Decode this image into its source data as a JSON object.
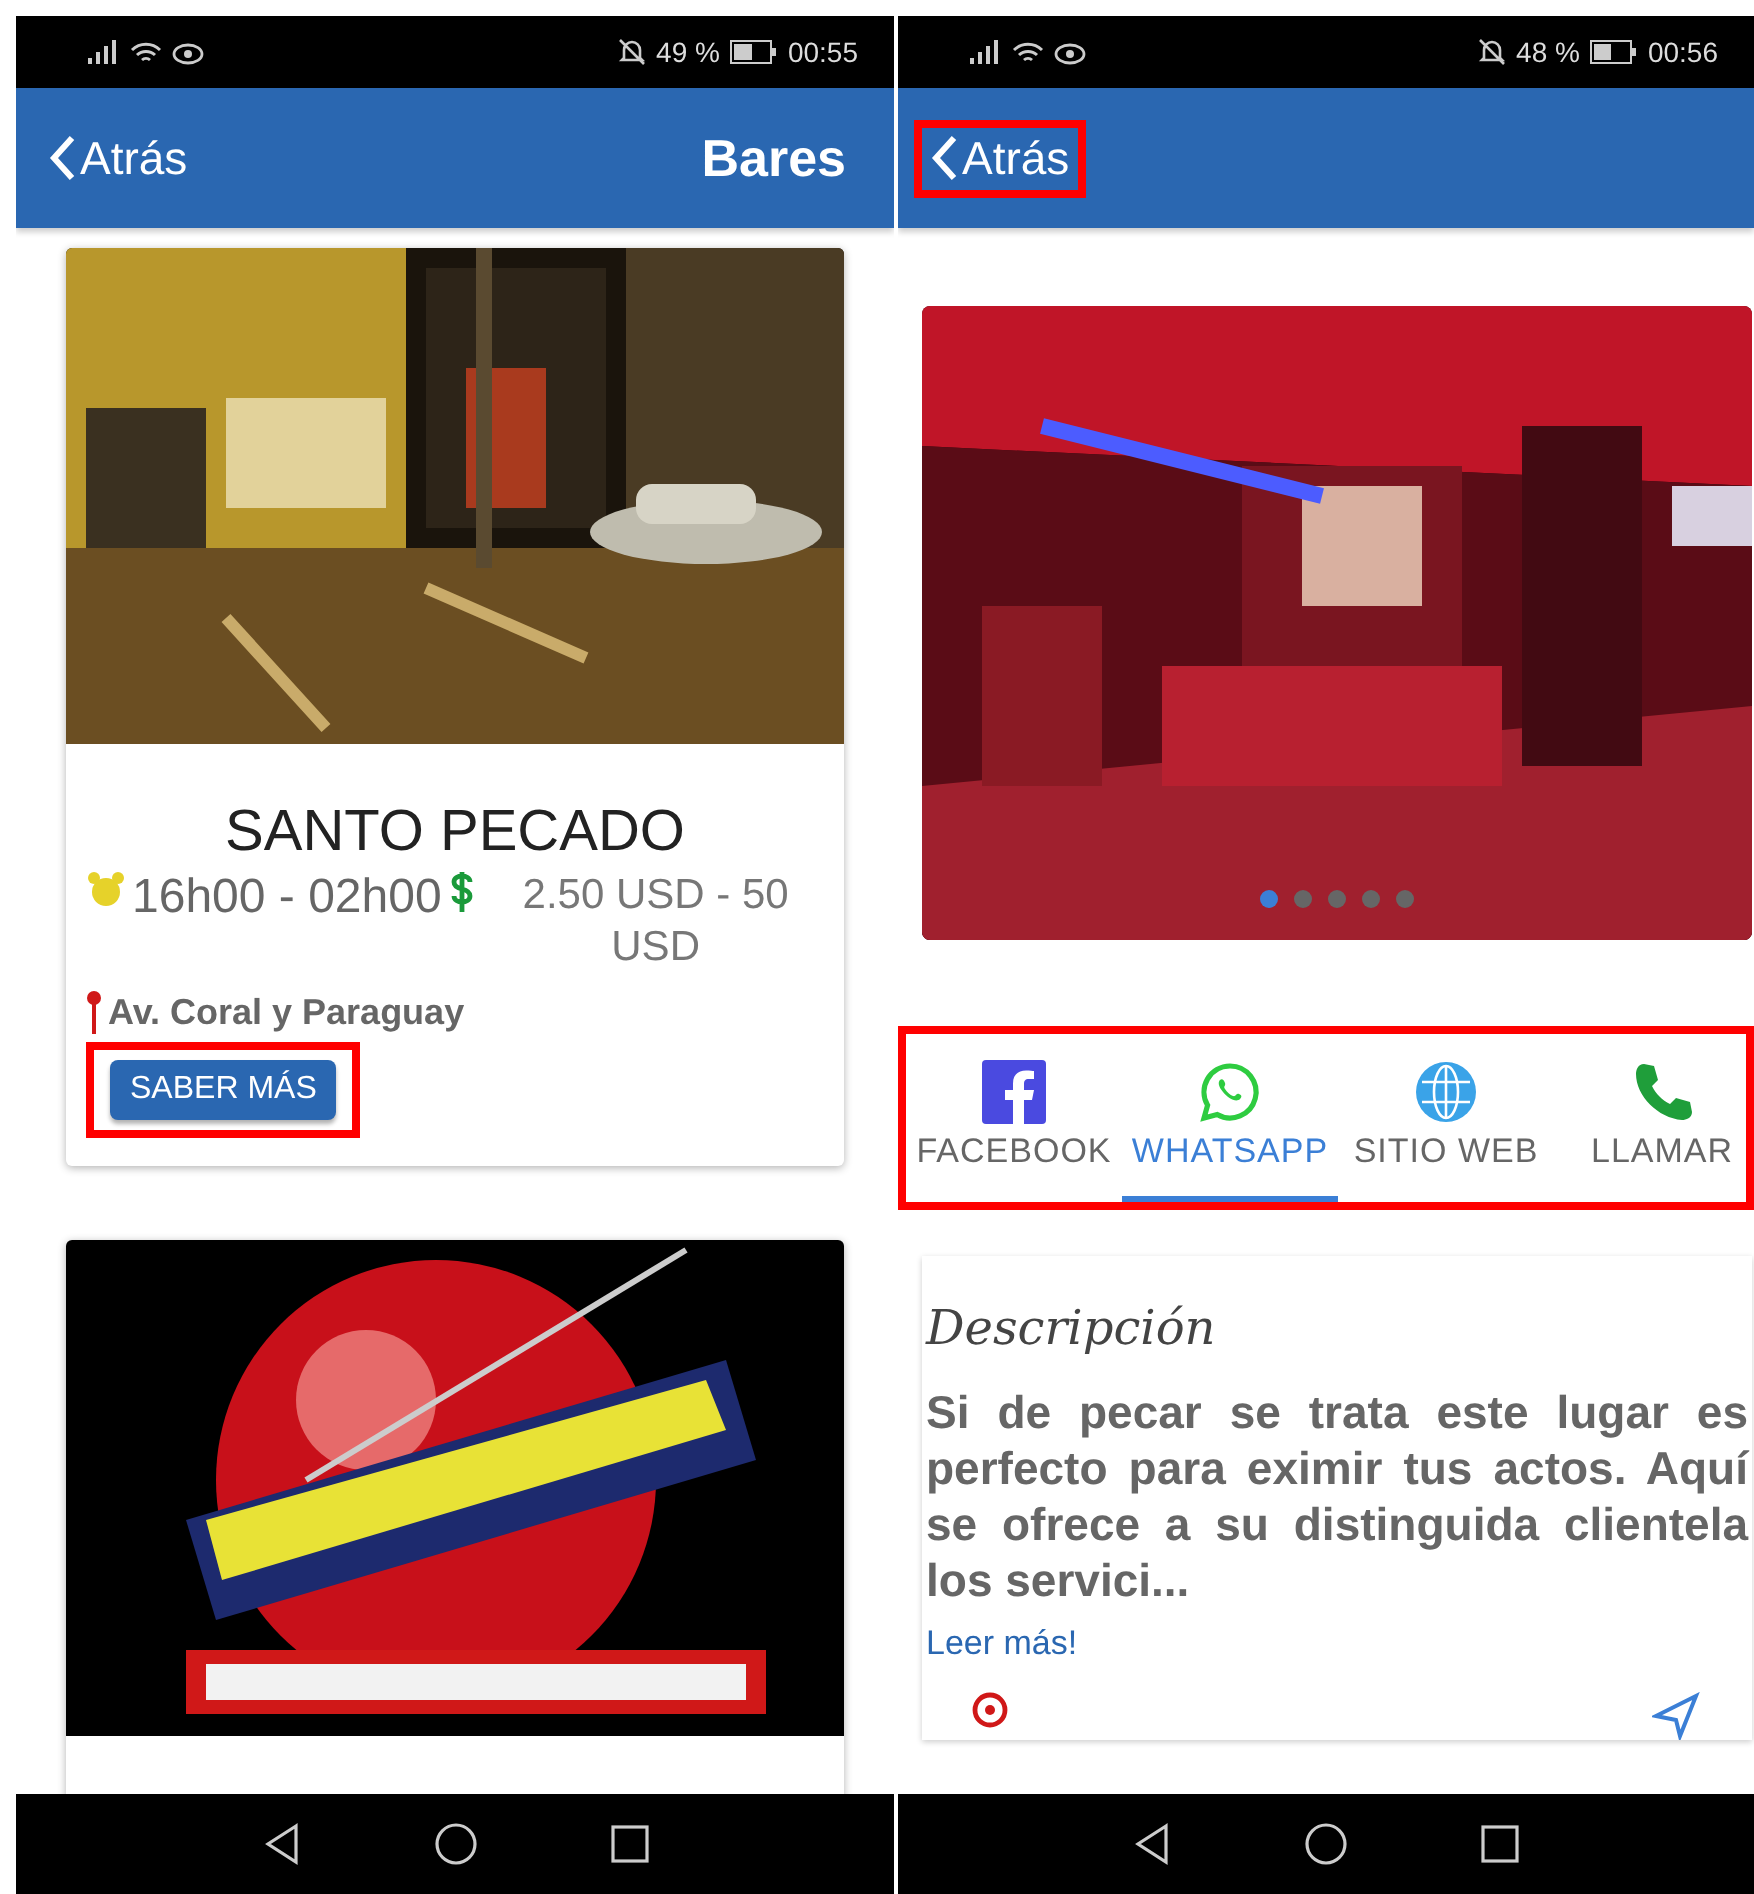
{
  "screens": [
    {
      "status_bar": {
        "battery": "49 %",
        "time": "00:55"
      },
      "header": {
        "back": "Atrás",
        "back_highlighted": false,
        "title": "Bares"
      },
      "cards": [
        {
          "name": "SANTO PECADO",
          "hours": "16h00 - 02h00",
          "price": "2.50 USD - 50 USD",
          "address": "Av. Coral y Paraguay",
          "button": "SABER MÁS",
          "button_highlighted": true
        },
        {
          "kind": "picture"
        }
      ]
    },
    {
      "status_bar": {
        "battery": "48 %",
        "time": "00:56"
      },
      "header": {
        "back": "Atrás",
        "back_highlighted": true
      },
      "carousel_dots": [
        {
          "selected": true
        },
        {
          "selected": false
        },
        {
          "selected": false
        },
        {
          "selected": false
        },
        {
          "selected": false
        }
      ],
      "tabs_highlighted": true,
      "tabs": [
        {
          "kind": "facebook",
          "label": "FACEBOOK",
          "selected": false
        },
        {
          "kind": "whatsapp",
          "label": "WHATSAPP",
          "selected": true
        },
        {
          "kind": "web",
          "label": "SITIO WEB",
          "selected": false
        },
        {
          "kind": "phone",
          "label": "LLAMAR",
          "selected": false
        }
      ],
      "description": {
        "title": "Descripción",
        "text": "Si de pecar se trata este lugar es perfecto para eximir tus actos. Aquí se ofrece a su distinguida clientela los servici...",
        "link": "Leer más!"
      }
    }
  ]
}
